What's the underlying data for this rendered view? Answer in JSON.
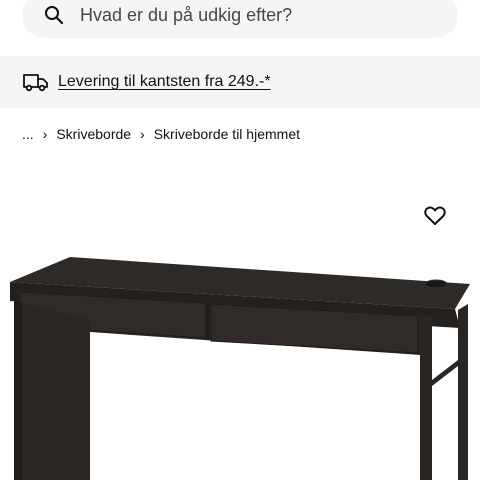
{
  "search": {
    "placeholder": "Hvad er du på udkig efter?"
  },
  "delivery_banner": {
    "text": "Levering til kantsten fra 249.-*"
  },
  "breadcrumb": {
    "ellipsis": "...",
    "items": [
      "Skriveborde",
      "Skriveborde til hjemmet"
    ]
  },
  "product": {
    "image_icon": "desk-image",
    "favourite_icon": "heart-icon"
  },
  "icons": {
    "search": "search-icon",
    "delivery": "truck-icon",
    "separator": "chevron-right-icon"
  },
  "colors": {
    "surface": "#f5f5f5",
    "text": "#111111",
    "desk": "#2e2a27"
  }
}
